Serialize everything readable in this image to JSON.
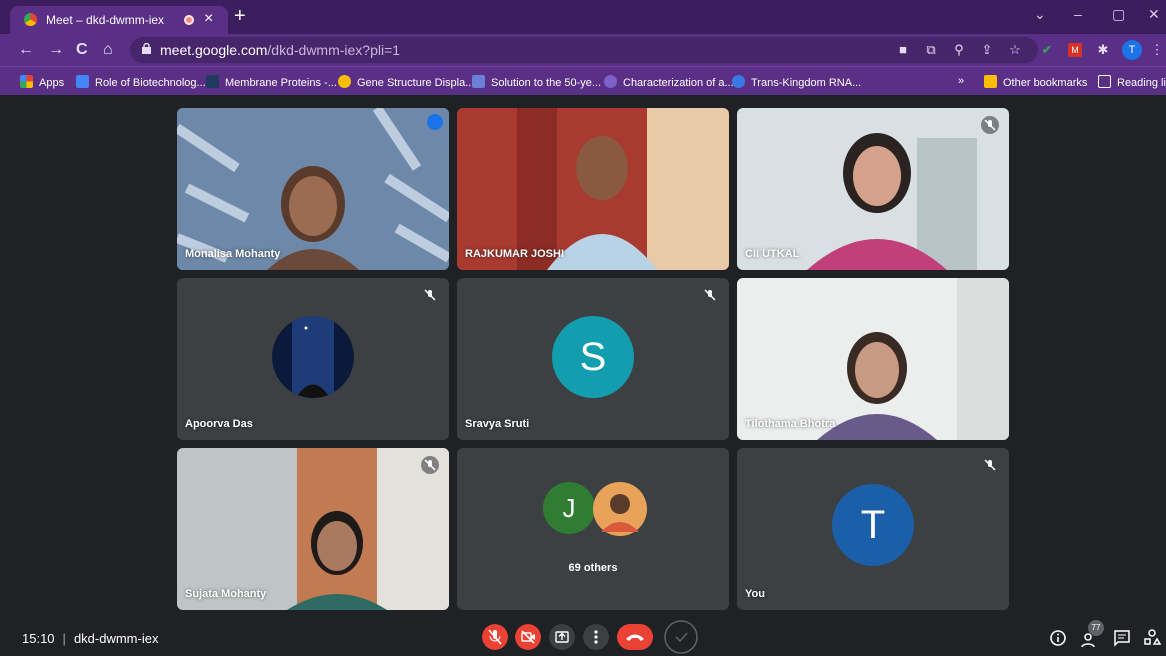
{
  "browser": {
    "tab_title": "Meet – dkd-dwmm-iex",
    "url_host": "meet.google.com",
    "url_path": "/dkd-dwmm-iex?pli=1",
    "profile_initial": "T"
  },
  "bookmarks": {
    "apps": "Apps",
    "items": [
      "Role of Biotechnolog...",
      "Membrane Proteins -...",
      "Gene Structure Displa...",
      "Solution to the 50-ye...",
      "Characterization of a...",
      "Trans-Kingdom RNA..."
    ],
    "overflow": "»",
    "other": "Other bookmarks",
    "reading_list": "Reading list"
  },
  "participants": [
    {
      "name": "Monalisa Mohanty",
      "state": "speaking"
    },
    {
      "name": "RAJKUMAR JOSHI",
      "state": "video"
    },
    {
      "name": "CII UTKAL",
      "state": "muted"
    },
    {
      "name": "Apoorva Das",
      "state": "muted"
    },
    {
      "name": "Sravya Sruti",
      "state": "muted",
      "initial": "S"
    },
    {
      "name": "Tilothama Bhotra",
      "state": "video"
    },
    {
      "name": "Sujata Mohanty",
      "state": "muted"
    },
    {
      "name": "69 others",
      "initial": "J"
    },
    {
      "name": "You",
      "state": "muted",
      "initial": "T"
    }
  ],
  "meeting": {
    "time": "15:10",
    "code": "dkd-dwmm-iex",
    "participant_count": "77"
  },
  "colors": {
    "chrome_bg": "#5a2f86",
    "danger_red": "#ea4335",
    "teal": "#129eaf",
    "green": "#2e7d32",
    "blue": "#1a5fa8"
  }
}
